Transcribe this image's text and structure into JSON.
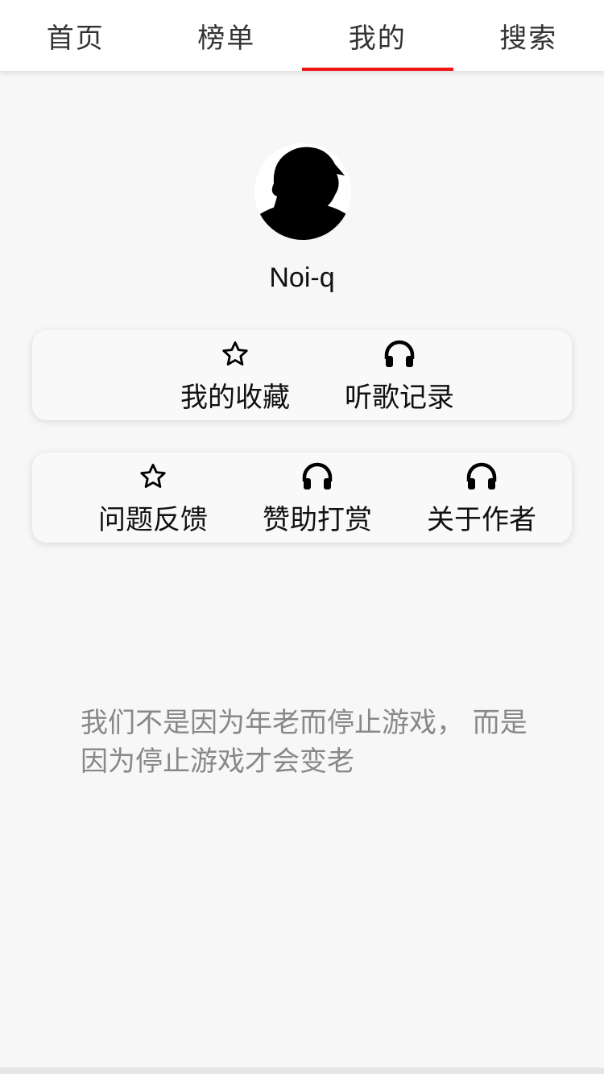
{
  "tabs": [
    {
      "label": "首页",
      "active": false
    },
    {
      "label": "榜单",
      "active": false
    },
    {
      "label": "我的",
      "active": true
    },
    {
      "label": "搜索",
      "active": false
    }
  ],
  "accent_color": "#f01414",
  "profile": {
    "username": "Noi-q",
    "avatar_icon": "silhouette-avatar"
  },
  "card1": {
    "items": [
      {
        "label": "我的收藏",
        "icon": "star-icon"
      },
      {
        "label": "听歌记录",
        "icon": "headphones-icon"
      }
    ]
  },
  "card2": {
    "items": [
      {
        "label": "问题反馈",
        "icon": "star-icon"
      },
      {
        "label": "赞助打赏",
        "icon": "headphones-icon"
      },
      {
        "label": "关于作者",
        "icon": "headphones-icon"
      }
    ]
  },
  "quote": "我们不是因为年老而停止游戏， 而是因为停止游戏才会变老"
}
